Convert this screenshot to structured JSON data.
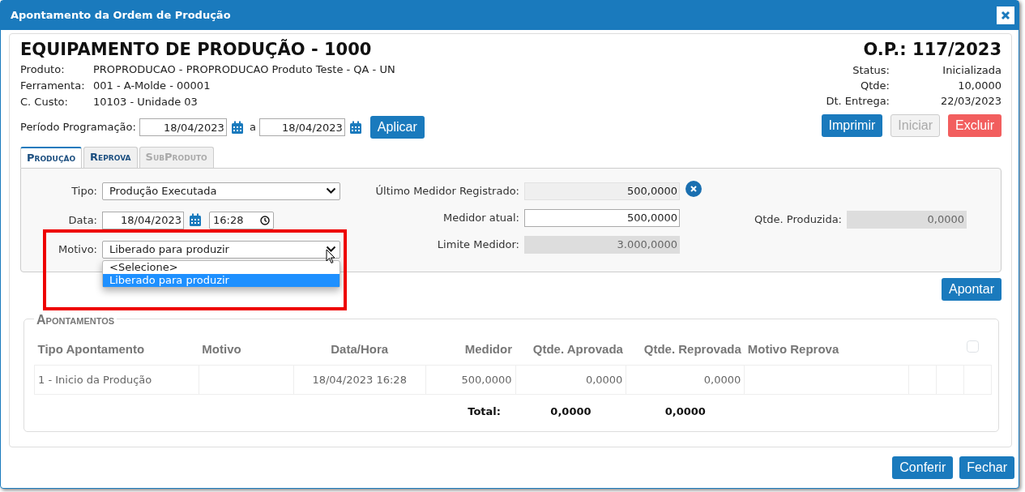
{
  "window": {
    "title": "Apontamento da Ordem de Produção"
  },
  "header": {
    "title": "EQUIPAMENTO DE PRODUÇÃO - 1000",
    "order": "O.P.: 117/2023",
    "info": [
      {
        "label": "Produto:",
        "value": "PROPRODUCAO - PROPRODUCAO Produto Teste - QA - UN"
      },
      {
        "label": "Ferramenta:",
        "value": "001 - A-Molde - 00001"
      },
      {
        "label": "C. Custo:",
        "value": "10103 - Unidade 03"
      }
    ],
    "status": [
      {
        "label": "Status:",
        "value": "Inicializada"
      },
      {
        "label": "Qtde:",
        "value": "10,0000"
      },
      {
        "label": "Dt. Entrega:",
        "value": "22/03/2023"
      }
    ]
  },
  "period": {
    "label": "Período Programação:",
    "from": "18/04/2023",
    "separator": "a",
    "to": "18/04/2023",
    "button": "Aplicar"
  },
  "actions": [
    {
      "label": "Imprimir",
      "kind": "primary",
      "disabled": false
    },
    {
      "label": "Iniciar",
      "kind": "default",
      "disabled": true
    },
    {
      "label": "Excluir",
      "kind": "danger",
      "disabled": false
    }
  ],
  "tabs": [
    {
      "label": "Produção",
      "selected": true,
      "disabled": false
    },
    {
      "label": "Reprova",
      "selected": false,
      "disabled": false
    },
    {
      "label": "SubProduto",
      "selected": false,
      "disabled": true
    }
  ],
  "form": {
    "tipo": {
      "label": "Tipo:",
      "value": "Produção Executada"
    },
    "data": {
      "label": "Data:",
      "date": "18/04/2023",
      "time": "16:28"
    },
    "motivo": {
      "label": "Motivo:",
      "value": "Liberado para produzir",
      "expanded": true,
      "options": [
        {
          "label": "<Selecione>",
          "selected": false
        },
        {
          "label": "Liberado para produzir",
          "selected": true
        }
      ]
    },
    "ultimo": {
      "label": "Último Medidor Registrado:",
      "value": "500,0000"
    },
    "atual": {
      "label": "Medidor atual:",
      "value": "500,0000"
    },
    "limite": {
      "label": "Limite Medidor:",
      "value": "3.000,0000"
    },
    "produzida": {
      "label": "Qtde. Produzida:",
      "value": "0,0000"
    }
  },
  "apontar": "Apontar",
  "apontamentos": {
    "legend": "Apontamentos",
    "columns": [
      "Tipo Apontamento",
      "Motivo",
      "Data/Hora",
      "Medidor",
      "Qtde. Aprovada",
      "Qtde. Reprovada",
      "Motivo Reprova"
    ],
    "select_all": {
      "checked": false
    },
    "rows": [
      {
        "cells": [
          "1 - Inicio da Produção",
          "",
          "18/04/2023 16:28",
          "500,0000",
          "0,0000",
          "0,0000",
          ""
        ]
      }
    ],
    "total": {
      "label": "Total:",
      "values": [
        "0,0000",
        "0,0000"
      ]
    }
  },
  "footer": [
    {
      "label": "Conferir"
    },
    {
      "label": "Fechar"
    }
  ]
}
